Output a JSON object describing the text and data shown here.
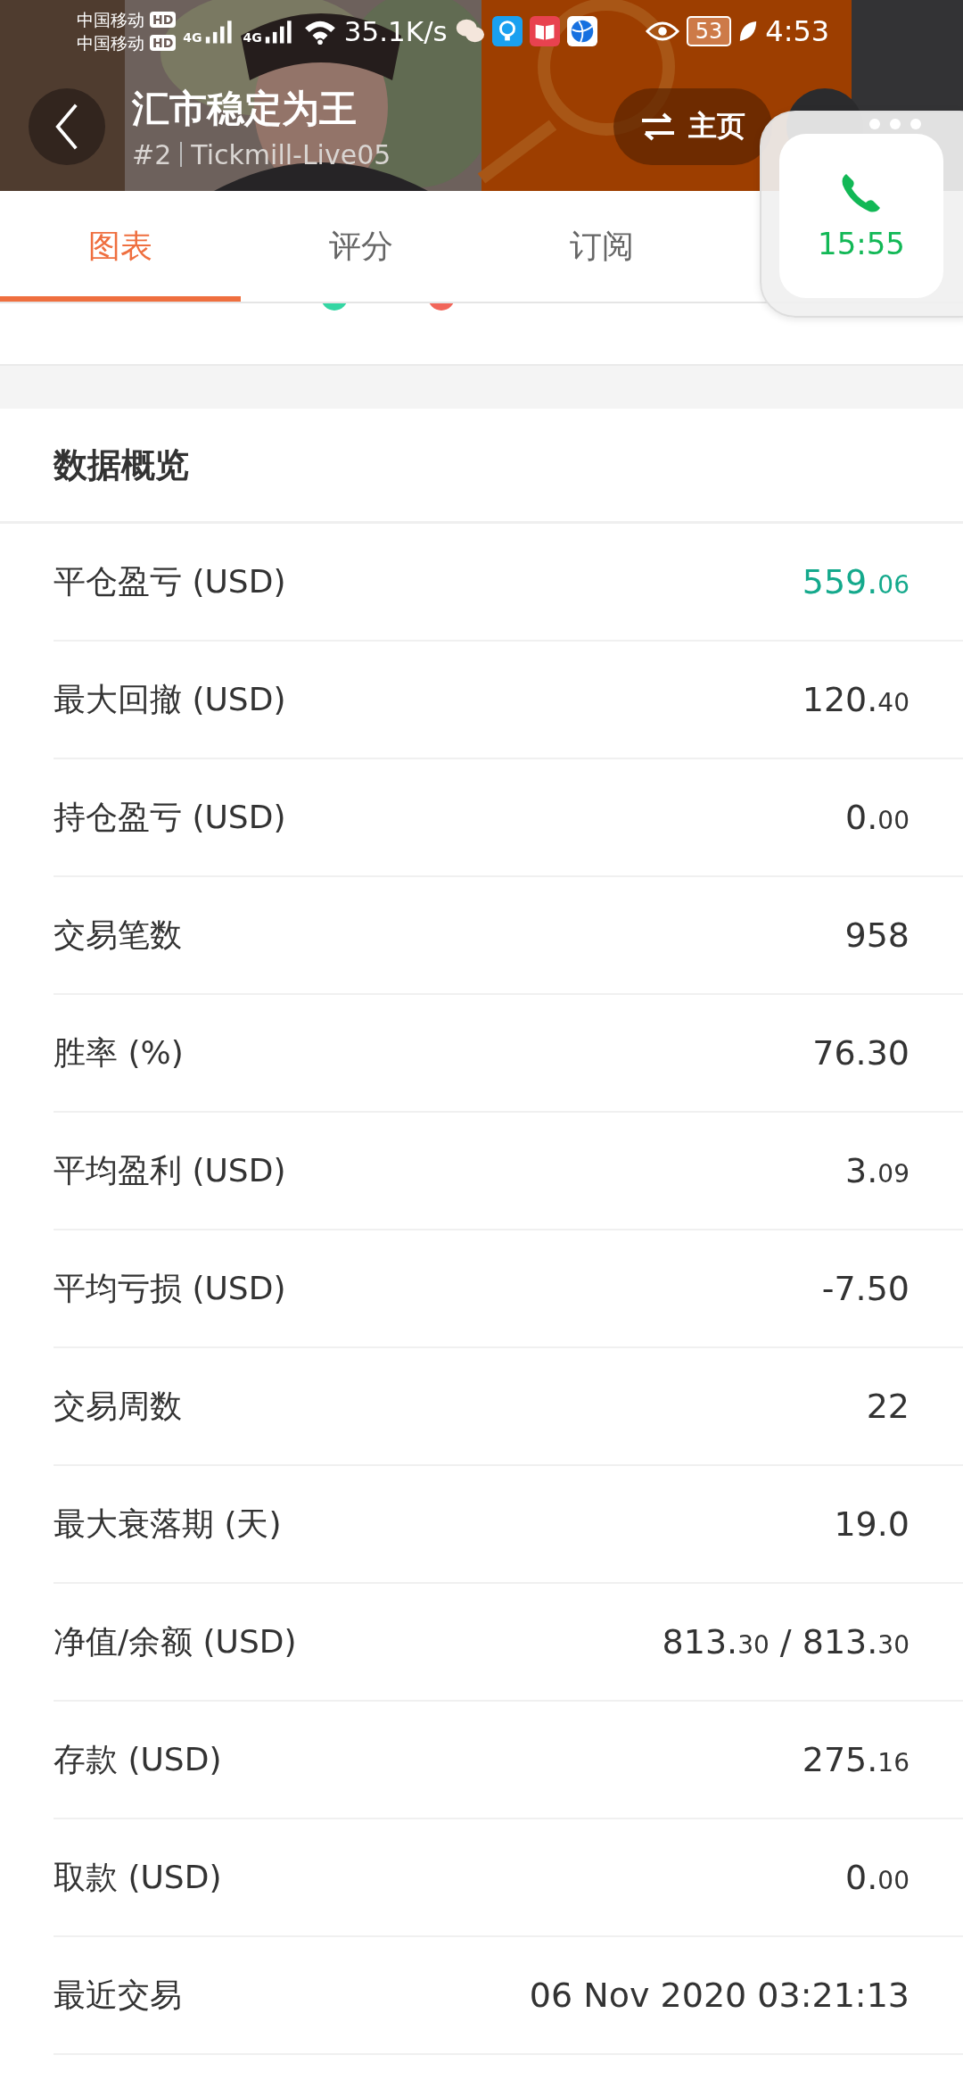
{
  "status_bar": {
    "carriers": [
      "中国移动",
      "中国移动"
    ],
    "hd_badges": [
      "HD",
      "HD"
    ],
    "network_labels": [
      "4G",
      "4G"
    ],
    "speed": "35.1K/s",
    "battery": "53",
    "time": "4:53"
  },
  "header": {
    "title": "汇市稳定为王",
    "rank": "#2",
    "account": "Tickmill-Live05",
    "home_button": "主页"
  },
  "call_widget": {
    "duration": "15:55"
  },
  "tabs": [
    {
      "label": "图表",
      "selected": true
    },
    {
      "label": "评分",
      "selected": false
    },
    {
      "label": "订阅",
      "selected": false
    }
  ],
  "legend": [
    {
      "color": "#34d6a3"
    },
    {
      "color": "#f1665a"
    }
  ],
  "overview": {
    "title": "数据概览",
    "rows": [
      {
        "label": "平仓盈亏 (USD)",
        "positive": true,
        "parts": [
          {
            "text": "559.",
            "small": false
          },
          {
            "text": "06",
            "small": true
          }
        ]
      },
      {
        "label": "最大回撤 (USD)",
        "positive": false,
        "parts": [
          {
            "text": "120.",
            "small": false
          },
          {
            "text": "40",
            "small": true
          }
        ]
      },
      {
        "label": "持仓盈亏 (USD)",
        "positive": false,
        "parts": [
          {
            "text": "0.",
            "small": false
          },
          {
            "text": "00",
            "small": true
          }
        ]
      },
      {
        "label": "交易笔数",
        "positive": false,
        "parts": [
          {
            "text": "958",
            "small": false
          }
        ]
      },
      {
        "label": "胜率 (%)",
        "positive": false,
        "parts": [
          {
            "text": "76.30",
            "small": false
          }
        ]
      },
      {
        "label": "平均盈利 (USD)",
        "positive": false,
        "parts": [
          {
            "text": "3.",
            "small": false
          },
          {
            "text": "09",
            "small": true
          }
        ]
      },
      {
        "label": "平均亏损 (USD)",
        "positive": false,
        "parts": [
          {
            "text": "-7.50",
            "small": false
          }
        ]
      },
      {
        "label": "交易周数",
        "positive": false,
        "parts": [
          {
            "text": "22",
            "small": false
          }
        ]
      },
      {
        "label": "最大衰落期 (天)",
        "positive": false,
        "parts": [
          {
            "text": "19.0",
            "small": false
          }
        ]
      },
      {
        "label": "净值/余额 (USD)",
        "positive": false,
        "parts": [
          {
            "text": "813.",
            "small": false
          },
          {
            "text": "30",
            "small": true
          },
          {
            "text": " / 813.",
            "small": false
          },
          {
            "text": "30",
            "small": true
          }
        ]
      },
      {
        "label": "存款 (USD)",
        "positive": false,
        "parts": [
          {
            "text": "275.",
            "small": false
          },
          {
            "text": "16",
            "small": true
          }
        ]
      },
      {
        "label": "取款 (USD)",
        "positive": false,
        "parts": [
          {
            "text": "0.",
            "small": false
          },
          {
            "text": "00",
            "small": true
          }
        ]
      },
      {
        "label": "最近交易",
        "positive": false,
        "parts": [
          {
            "text": "06 Nov 2020 03:21:13",
            "small": false
          }
        ]
      }
    ]
  }
}
